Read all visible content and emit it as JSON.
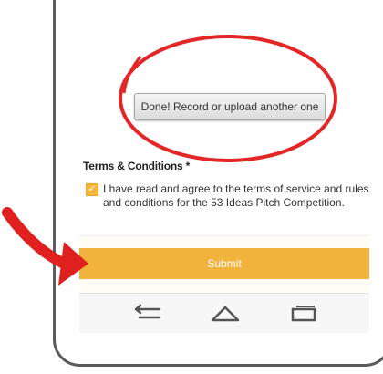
{
  "screen": {
    "done_button_label": "Done! Record or upload another one",
    "terms": {
      "heading": "Terms & Conditions *",
      "agreement_text": "I have read and agree to the terms of service and rules and conditions for the 53 Ideas Pitch Competition.",
      "checked": true
    },
    "submit_label": "Submit"
  },
  "navbar": {
    "icons": [
      "back-icon",
      "home-icon",
      "recent-apps-icon"
    ]
  },
  "colors": {
    "accent": "#f2b33c",
    "annotation_red": "#e32626"
  }
}
